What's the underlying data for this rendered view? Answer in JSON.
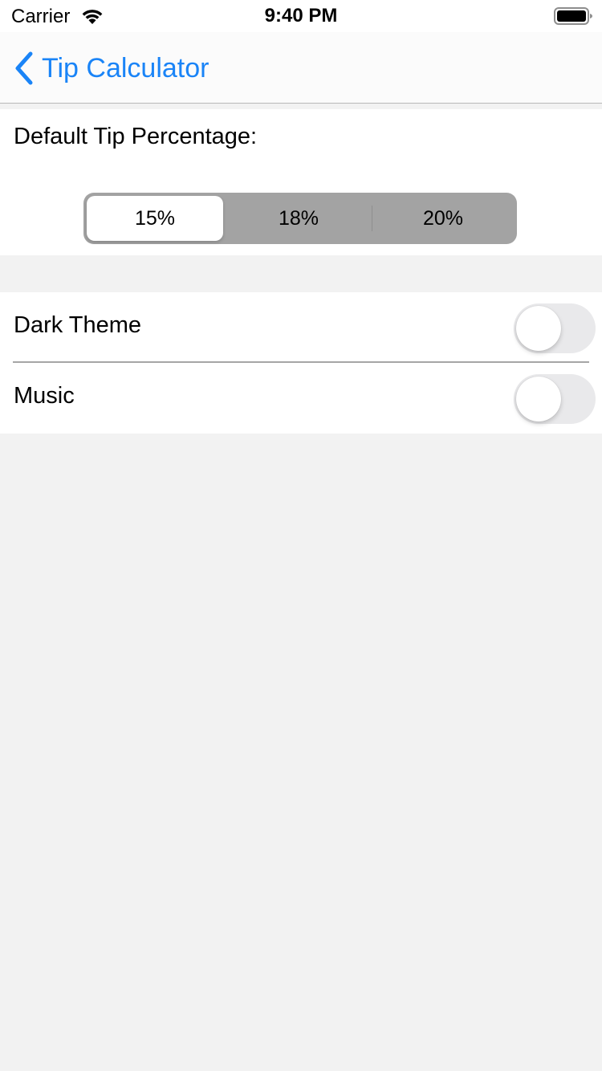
{
  "status_bar": {
    "carrier": "Carrier",
    "time": "9:40 PM",
    "icons": [
      "wifi-icon",
      "battery-icon"
    ]
  },
  "nav": {
    "back_label": "Tip Calculator",
    "back_icon": "chevron-left-icon",
    "accent_color": "#1a84f7"
  },
  "tip": {
    "label": "Default Tip Percentage:",
    "options": [
      "15%",
      "18%",
      "20%"
    ],
    "selected_index": 0,
    "selected_value": "15%"
  },
  "settings": {
    "rows": [
      {
        "label": "Dark Theme",
        "on": false
      },
      {
        "label": "Music",
        "on": false
      }
    ]
  }
}
